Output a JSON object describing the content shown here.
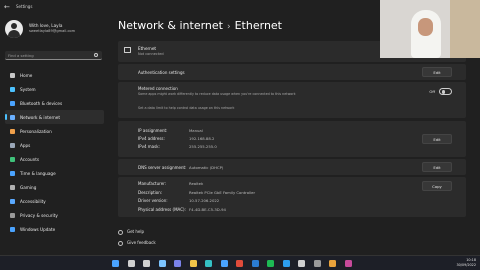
{
  "window": {
    "title": "Settings",
    "back_glyph": "←"
  },
  "profile": {
    "name": "With love, Layla",
    "email": "sweetlayla89@gmail.com"
  },
  "search": {
    "placeholder": "Find a setting"
  },
  "nav": [
    {
      "label": "Home",
      "icon": "home-icon",
      "color": "#c8c8c8",
      "active": false
    },
    {
      "label": "System",
      "icon": "system-icon",
      "color": "#4cc2ff",
      "active": false
    },
    {
      "label": "Bluetooth & devices",
      "icon": "bluetooth-icon",
      "color": "#4aa3ff",
      "active": false
    },
    {
      "label": "Network & internet",
      "icon": "network-icon",
      "color": "#6ab0ff",
      "active": true
    },
    {
      "label": "Personalization",
      "icon": "brush-icon",
      "color": "#f0a04b",
      "active": false
    },
    {
      "label": "Apps",
      "icon": "apps-icon",
      "color": "#9aa7b8",
      "active": false
    },
    {
      "label": "Accounts",
      "icon": "accounts-icon",
      "color": "#3fc27a",
      "active": false
    },
    {
      "label": "Time & language",
      "icon": "globe-icon",
      "color": "#4aa3ff",
      "active": false
    },
    {
      "label": "Gaming",
      "icon": "gaming-icon",
      "color": "#b0b0b0",
      "active": false
    },
    {
      "label": "Accessibility",
      "icon": "accessibility-icon",
      "color": "#5aa9ff",
      "active": false
    },
    {
      "label": "Privacy & security",
      "icon": "shield-icon",
      "color": "#9a9a9a",
      "active": false
    },
    {
      "label": "Windows Update",
      "icon": "update-icon",
      "color": "#4aa3ff",
      "active": false
    }
  ],
  "header": {
    "section": "Network & internet",
    "separator": "›",
    "page": "Ethernet"
  },
  "ethernet": {
    "title": "Ethernet",
    "status": "Not connected"
  },
  "auth": {
    "label": "Authentication settings",
    "edit": "Edit"
  },
  "metered": {
    "label": "Metered connection",
    "description": "Some apps might work differently to reduce data usage when you're connected to this network",
    "toggle_label": "Off",
    "toggle_on": false,
    "hint": "Set a data limit to help control data usage on this network"
  },
  "ip": {
    "rows": [
      {
        "label": "IP assignment:",
        "value": "Manual"
      },
      {
        "label": "IPv4 address:",
        "value": "192.168.88.2"
      },
      {
        "label": "IPv4 mask:",
        "value": "255.255.255.0"
      }
    ],
    "edit": "Edit"
  },
  "dns": {
    "label": "DNS server assignment:",
    "value": "Automatic (DHCP)",
    "edit": "Edit"
  },
  "info": {
    "rows": [
      {
        "label": "Manufacturer:",
        "value": "Realtek"
      },
      {
        "label": "Description:",
        "value": "Realtek PCIe GbE Family Controller"
      },
      {
        "label": "Driver version:",
        "value": "10.57.206.2022"
      },
      {
        "label": "Physical address (MAC):",
        "value": "F4-4D-BE-C5-3D-94"
      }
    ],
    "copy": "Copy"
  },
  "footer": {
    "help": "Get help",
    "feedback": "Give feedback"
  },
  "taskbar": {
    "icons": [
      {
        "name": "start-icon",
        "color": "#4aa3ff"
      },
      {
        "name": "search-taskbar-icon",
        "color": "#d0d0d0"
      },
      {
        "name": "taskview-icon",
        "color": "#d0d0d0"
      },
      {
        "name": "widgets-icon",
        "color": "#7cc4ff"
      },
      {
        "name": "chat-icon",
        "color": "#7b83eb"
      },
      {
        "name": "explorer-icon",
        "color": "#f3c649"
      },
      {
        "name": "edge-icon",
        "color": "#35c1c6"
      },
      {
        "name": "store-icon",
        "color": "#4aa3ff"
      },
      {
        "name": "chrome-icon",
        "color": "#e04b3b"
      },
      {
        "name": "word-icon",
        "color": "#2b7cd3"
      },
      {
        "name": "spotify-icon",
        "color": "#1db954"
      },
      {
        "name": "vscode-icon",
        "color": "#2d9ff0"
      },
      {
        "name": "app-icon-1",
        "color": "#d0d0d0"
      },
      {
        "name": "settings-taskbar-icon",
        "color": "#9a9a9a"
      },
      {
        "name": "app-icon-2",
        "color": "#e9a23b"
      },
      {
        "name": "app-icon-3",
        "color": "#c74a9b"
      }
    ],
    "time": "10:18",
    "date": "30/09/2022"
  }
}
